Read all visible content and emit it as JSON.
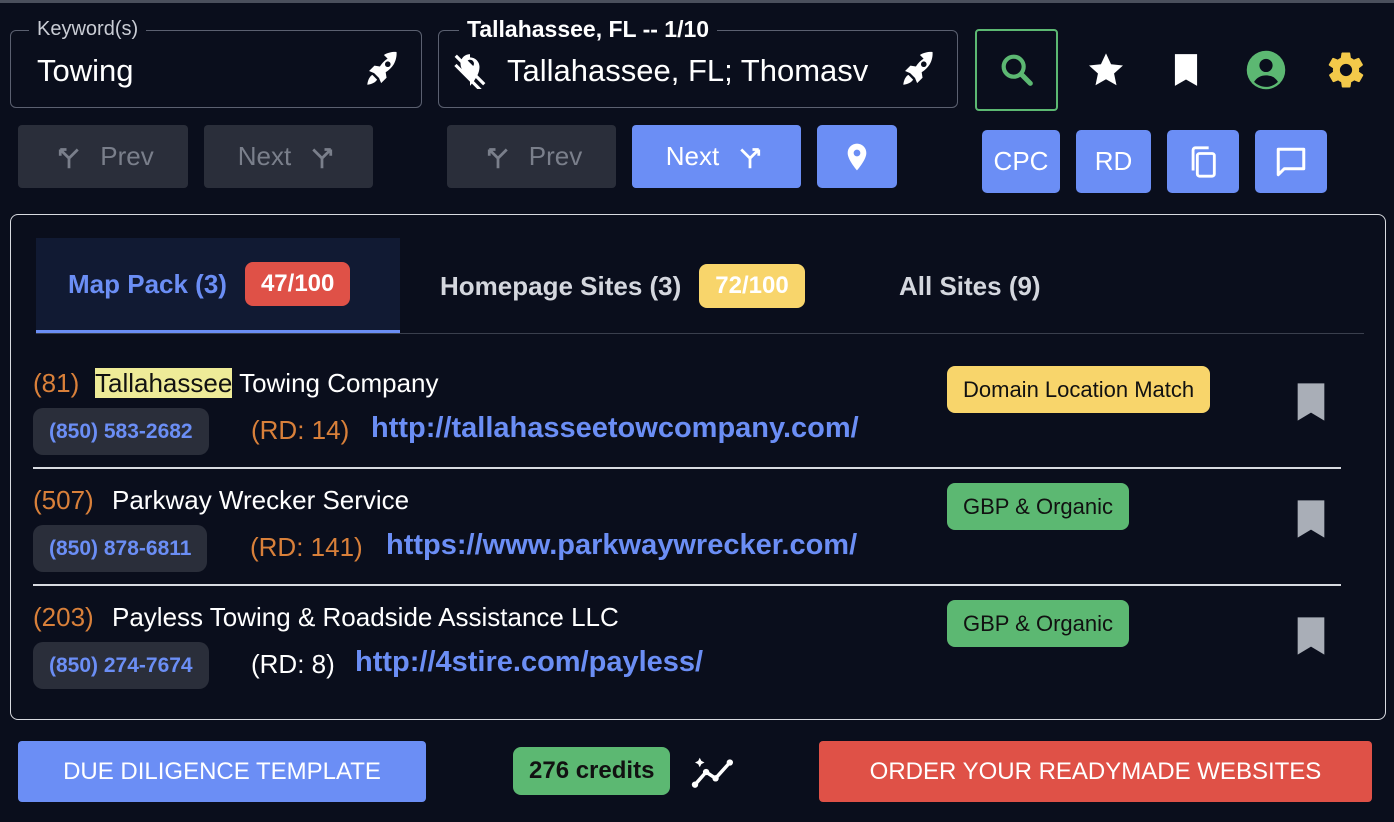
{
  "keyword_field": {
    "legend": "Keyword(s)",
    "value": "Towing"
  },
  "location_field": {
    "legend": "Tallahassee, FL -- 1/10",
    "value": "Tallahassee, FL; Thomasv"
  },
  "nav": {
    "keyword_prev": "Prev",
    "keyword_next": "Next",
    "location_prev": "Prev",
    "location_next": "Next"
  },
  "tools": {
    "cpc": "CPC",
    "rd": "RD"
  },
  "tabs": [
    {
      "label": "Map Pack (3)",
      "score": "47/100"
    },
    {
      "label": "Homepage Sites (3)",
      "score": "72/100"
    },
    {
      "label": "All Sites (9)"
    }
  ],
  "results": [
    {
      "rank": "(81)",
      "name_highlight": "Tallahassee",
      "name_rest": " Towing Company",
      "phone": "(850) 583-2682",
      "rd": "(RD: 14)",
      "url": "http://tallahasseetowcompany.com/",
      "badge": "Domain Location Match"
    },
    {
      "rank": "(507)",
      "name_highlight": "",
      "name_rest": "Parkway Wrecker Service",
      "phone": "(850) 878-6811",
      "rd": "(RD: 141)",
      "url": "https://www.parkwaywrecker.com/",
      "badge": "GBP & Organic"
    },
    {
      "rank": "(203)",
      "name_highlight": "",
      "name_rest": "Payless Towing & Roadside Assistance LLC",
      "phone": "(850) 274-7674",
      "rd": "(RD: 8)",
      "url": "http://4stire.com/payless/",
      "badge": "GBP & Organic"
    }
  ],
  "footer": {
    "due_diligence": "DUE DILIGENCE TEMPLATE",
    "credits": "276 credits",
    "order": "ORDER YOUR READYMADE WEBSITES"
  },
  "colors": {
    "background": "#0a0e1c",
    "accent_blue": "#6b8ef5",
    "orange": "#d9803a",
    "red": "#df5147",
    "yellow": "#f8d56b",
    "green": "#5cb872"
  },
  "icons": [
    "rocket-icon",
    "location-off-icon",
    "search-icon",
    "star-icon",
    "bookmark-icon",
    "account-icon",
    "gear-icon",
    "fork-left-icon",
    "fork-right-icon",
    "map-pin-icon",
    "copy-icon",
    "comment-icon",
    "trend-chart-icon"
  ]
}
